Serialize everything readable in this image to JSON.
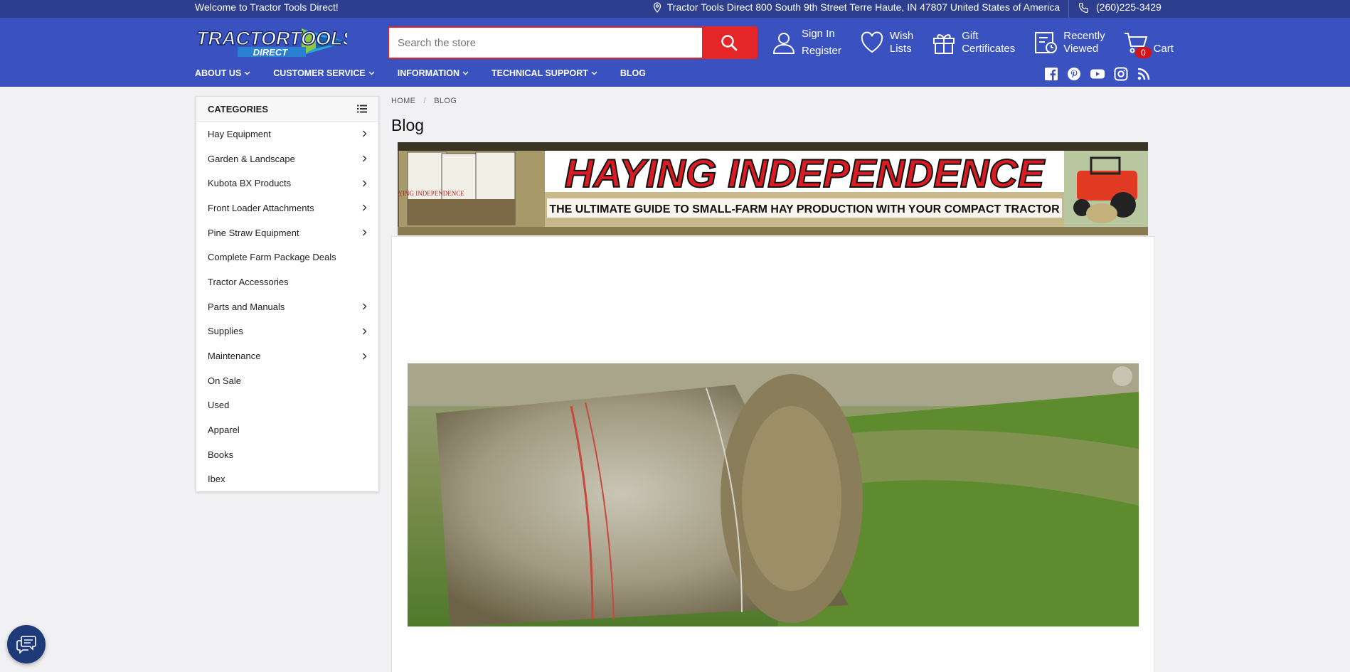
{
  "topbar": {
    "welcome": "Welcome to Tractor Tools Direct!",
    "address": "Tractor Tools Direct 800 South 9th Street Terre Haute, IN 47807 United States of America",
    "phone": "(260)225-3429"
  },
  "header": {
    "logo_text": "TRACTORTOOLS",
    "logo_sub": "DIRECT",
    "search_placeholder": "Search the store",
    "sign_in": "Sign In",
    "register": "Register",
    "wish_1": "Wish",
    "wish_2": "Lists",
    "gift_1": "Gift",
    "gift_2": "Certificates",
    "recent_1": "Recently",
    "recent_2": "Viewed",
    "cart_label": "Cart",
    "cart_count": "0"
  },
  "nav": {
    "items": [
      "ABOUT US",
      "CUSTOMER SERVICE",
      "INFORMATION",
      "TECHNICAL SUPPORT",
      "BLOG"
    ]
  },
  "sidebar": {
    "title": "CATEGORIES",
    "items": [
      {
        "label": "Hay Equipment",
        "has_sub": true
      },
      {
        "label": "Garden & Landscape",
        "has_sub": true
      },
      {
        "label": "Kubota BX Products",
        "has_sub": true
      },
      {
        "label": "Front Loader Attachments",
        "has_sub": true
      },
      {
        "label": "Pine Straw Equipment",
        "has_sub": true
      },
      {
        "label": "Complete Farm Package Deals",
        "has_sub": false
      },
      {
        "label": "Tractor Accessories",
        "has_sub": false
      },
      {
        "label": "Parts and Manuals",
        "has_sub": true
      },
      {
        "label": "Supplies",
        "has_sub": true
      },
      {
        "label": "Maintenance",
        "has_sub": true
      },
      {
        "label": "On Sale",
        "has_sub": false
      },
      {
        "label": "Used",
        "has_sub": false
      },
      {
        "label": "Apparel",
        "has_sub": false
      },
      {
        "label": "Books",
        "has_sub": false
      },
      {
        "label": "Ibex",
        "has_sub": false
      }
    ]
  },
  "breadcrumb": {
    "home": "HOME",
    "sep": "/",
    "current": "BLOG"
  },
  "page": {
    "title": "Blog"
  },
  "banner": {
    "headline": "HAYING INDEPENDENCE",
    "subline": "THE ULTIMATE GUIDE TO SMALL-FARM HAY PRODUCTION WITH YOUR COMPACT TRACTOR",
    "book_text": "HAYING INDEPENDENCE"
  },
  "colors": {
    "brand_blue": "#3a52c0",
    "top_blue": "#2d3e8f",
    "accent_red": "#e52629"
  },
  "icons": [
    "location-pin-icon",
    "phone-icon",
    "search-icon",
    "user-icon",
    "heart-icon",
    "gift-icon",
    "recent-icon",
    "cart-icon",
    "list-icon",
    "chevron-right-icon",
    "facebook-icon",
    "pinterest-icon",
    "youtube-icon",
    "instagram-icon",
    "rss-icon",
    "chat-icon"
  ]
}
